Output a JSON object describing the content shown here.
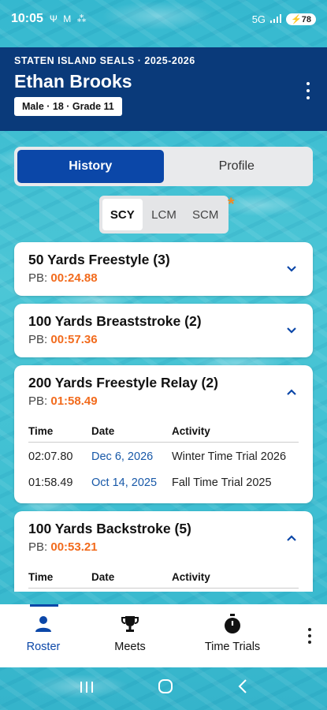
{
  "status_bar": {
    "time": "10:05",
    "left_icons": "Ψ M ⁂",
    "network": "5G",
    "battery": "78"
  },
  "header": {
    "team_season": "STATEN ISLAND SEALS · 2025-2026",
    "athlete_name": "Ethan Brooks",
    "athlete_meta": "Male · 18 · Grade 11"
  },
  "tabs": [
    {
      "label": "History",
      "active": true
    },
    {
      "label": "Profile",
      "active": false
    }
  ],
  "course": {
    "options": [
      "SCY",
      "LCM",
      "SCM"
    ],
    "selected": "SCY",
    "indicator": "*"
  },
  "events": [
    {
      "title": "50 Yards Freestyle (3)",
      "pb_label": "PB:",
      "pb": "00:24.88",
      "expanded": false
    },
    {
      "title": "100 Yards Breaststroke (2)",
      "pb_label": "PB:",
      "pb": "00:57.36",
      "expanded": false
    },
    {
      "title": "200 Yards Freestyle Relay (2)",
      "pb_label": "PB:",
      "pb": "01:58.49",
      "expanded": true,
      "columns": [
        "Time",
        "Date",
        "Activity"
      ],
      "rows": [
        {
          "time": "02:07.80",
          "date": "Dec 6, 2026",
          "activity": "Winter Time Trial 2026"
        },
        {
          "time": "01:58.49",
          "date": "Oct 14, 2025",
          "activity": "Fall Time Trial 2025"
        }
      ]
    },
    {
      "title": "100 Yards Backstroke (5)",
      "pb_label": "PB:",
      "pb": "00:53.21",
      "expanded": true,
      "columns": [
        "Time",
        "Date",
        "Activity"
      ],
      "rows": []
    }
  ],
  "bottom_nav": [
    {
      "label": "Roster",
      "icon": "person-icon",
      "active": true
    },
    {
      "label": "Meets",
      "icon": "trophy-icon",
      "active": false
    },
    {
      "label": "Time Trials",
      "icon": "stopwatch-icon",
      "active": false
    }
  ],
  "colors": {
    "header_bg": "#0a3a7a",
    "accent": "#0b47a8",
    "pb_orange": "#f26b1d",
    "date_link": "#1758a8"
  }
}
